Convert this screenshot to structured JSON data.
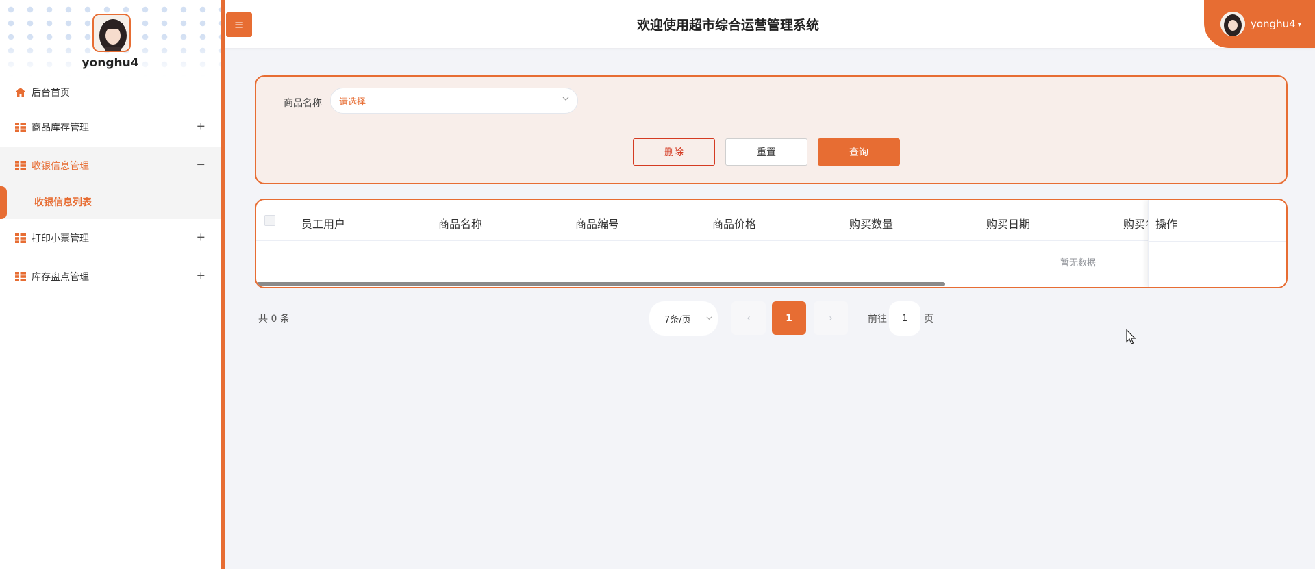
{
  "sidebar": {
    "username": "yonghu4",
    "menu": [
      {
        "label": "后台首页",
        "icon": "home-icon"
      },
      {
        "label": "商品库存管理",
        "icon": "grid-icon",
        "toggle": "+"
      },
      {
        "label": "收银信息管理",
        "icon": "grid-icon",
        "toggle": "−",
        "expanded": true,
        "children": [
          {
            "label": "收银信息列表",
            "active": true
          }
        ]
      },
      {
        "label": "打印小票管理",
        "icon": "grid-icon",
        "toggle": "+"
      },
      {
        "label": "库存盘点管理",
        "icon": "grid-icon",
        "toggle": "+"
      }
    ]
  },
  "header": {
    "menu_button_icon": "hamburger-icon",
    "title": "欢迎使用超市综合运营管理系统",
    "user": "yonghu4"
  },
  "search": {
    "field_label": "商品名称",
    "select_placeholder": "请选择",
    "buttons": {
      "delete": "删除",
      "reset": "重置",
      "query": "查询"
    }
  },
  "table": {
    "columns": [
      "员工用户",
      "商品名称",
      "商品编号",
      "商品价格",
      "购买数量",
      "购买日期",
      "购买名"
    ],
    "action_column": "操作",
    "empty_text": "暂无数据",
    "rows": []
  },
  "pagination": {
    "total_text": "共 0 条",
    "page_size": "7条/页",
    "prev": "‹",
    "current_page": "1",
    "next": "›",
    "goto_label": "前往",
    "goto_value": "1",
    "goto_suffix": "页"
  },
  "colors": {
    "accent": "#e76d33",
    "danger": "#d43b23",
    "background": "#f3f4f8"
  }
}
